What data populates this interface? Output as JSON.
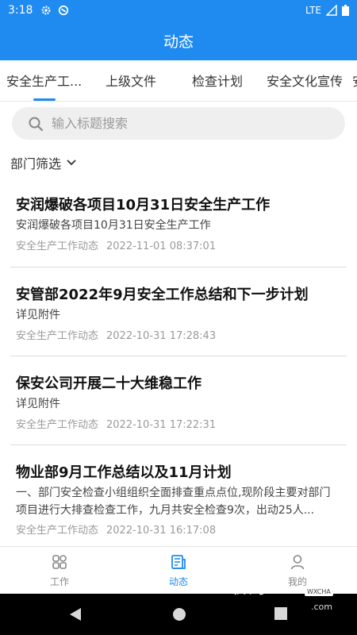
{
  "status_bar": {
    "time": "3:18",
    "network": "LTE"
  },
  "app_bar": {
    "title": "动态"
  },
  "tabs": [
    {
      "label": "安全生产工...",
      "active": true
    },
    {
      "label": "上级文件",
      "active": false
    },
    {
      "label": "检查计划",
      "active": false
    },
    {
      "label": "安全文化宣传",
      "active": false
    },
    {
      "label": "安",
      "active": false
    }
  ],
  "search": {
    "placeholder": "输入标题搜索",
    "value": ""
  },
  "filter": {
    "label": "部门筛选"
  },
  "articles": [
    {
      "title": "安润爆破各项目10月31日安全生产工作",
      "summary": "安润爆破各项目10月31日安全生产工作",
      "category": "安全生产工作动态",
      "date": "2022-11-01 08:37:01"
    },
    {
      "title": "安管部2022年9月安全工作总结和下一步计划",
      "summary": "详见附件",
      "category": "安全生产工作动态",
      "date": "2022-10-31 17:28:43"
    },
    {
      "title": "保安公司开展二十大维稳工作",
      "summary": "详见附件",
      "category": "安全生产工作动态",
      "date": "2022-10-31 17:22:31"
    },
    {
      "title": "物业部9月工作总结以及11月计划",
      "summary": "一、部门安全检查小组组织全面排查重点点位,现阶段主要对部门项目进行大排查检查工作，九月共安全检查9次，出动25人...",
      "category": "安全生产工作动态",
      "date": "2022-10-31 16:17:08"
    }
  ],
  "bottom_nav": [
    {
      "label": "工作",
      "icon": "grid-icon",
      "active": false
    },
    {
      "label": "动态",
      "icon": "news-icon",
      "active": true
    },
    {
      "label": "我的",
      "icon": "person-icon",
      "active": false
    }
  ],
  "watermark": {
    "text": "微茶",
    "badge": "WXCHA",
    "url": ".com"
  },
  "colors": {
    "primary": "#1f8bf0",
    "text_muted": "#9a9a9a",
    "divider": "#dcdcdc"
  }
}
